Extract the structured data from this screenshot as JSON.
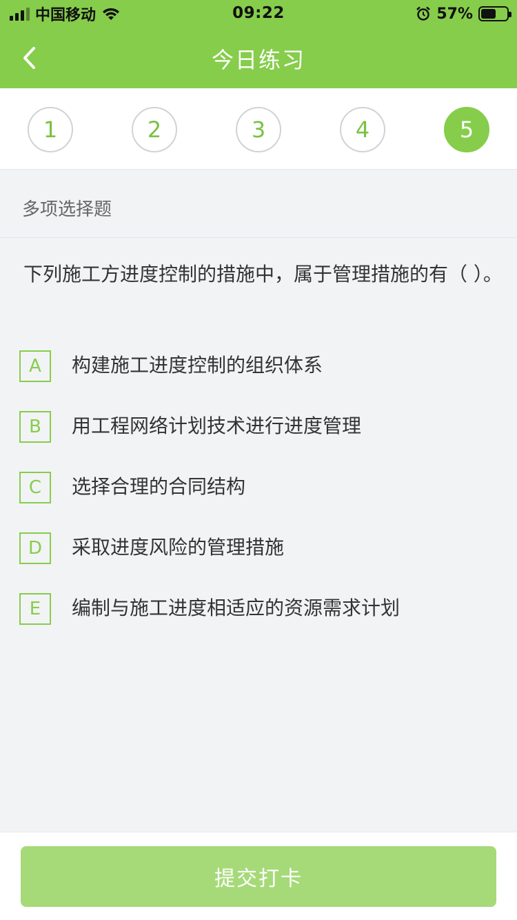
{
  "status_bar": {
    "carrier": "中国移动",
    "time": "09:22",
    "battery_percent": "57%",
    "battery_level": 0.57
  },
  "nav": {
    "title": "今日练习",
    "back_icon": "chevron-left-icon"
  },
  "steps": {
    "items": [
      "1",
      "2",
      "3",
      "4",
      "5"
    ],
    "active_index": 4
  },
  "question": {
    "type": "多项选择题",
    "text": "下列施工方进度控制的措施中，属于管理措施的有（ ）。",
    "options": [
      {
        "key": "A",
        "text": "构建施工进度控制的组织体系"
      },
      {
        "key": "B",
        "text": "用工程网络计划技术进行进度管理"
      },
      {
        "key": "C",
        "text": "选择合理的合同结构"
      },
      {
        "key": "D",
        "text": "采取进度风险的管理措施"
      },
      {
        "key": "E",
        "text": "编制与施工进度相适应的资源需求计划"
      }
    ]
  },
  "footer": {
    "submit_label": "提交打卡"
  },
  "colors": {
    "brand_green": "#86cd4b",
    "button_green_disabled": "#a6da78",
    "background": "#f2f3f5"
  }
}
